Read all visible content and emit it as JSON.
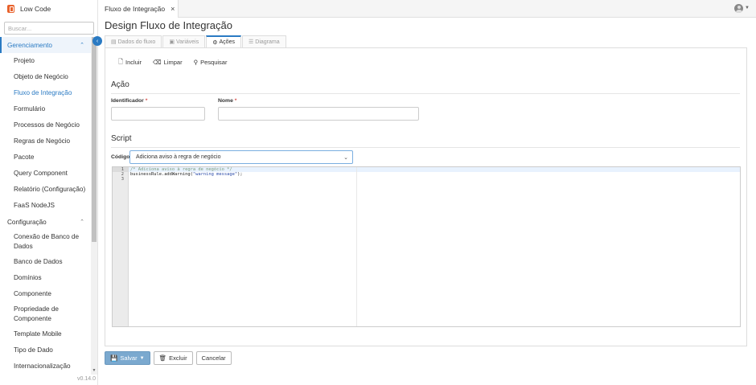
{
  "brand": {
    "name": "Low Code"
  },
  "sidebar": {
    "search_placeholder": "Buscar...",
    "groups": [
      {
        "label": "Gerenciamento",
        "expanded": true,
        "items": [
          "Projeto",
          "Objeto de Negócio",
          "Fluxo de Integração",
          "Formulário",
          "Processos de Negócio",
          "Regras de Negócio",
          "Pacote",
          "Query Component",
          "Relatório (Configuração)",
          "FaaS NodeJS"
        ]
      },
      {
        "label": "Configuração",
        "expanded": true,
        "items": [
          "Conexão de Banco de Dados",
          "Banco de Dados",
          "Domínios",
          "Componente",
          "Propriedade de Componente",
          "Template Mobile",
          "Tipo de Dado",
          "Internacionalização"
        ]
      }
    ],
    "active_item": "Fluxo de Integração",
    "version": "v0.14.0"
  },
  "topbar": {
    "tab_label": "Fluxo de Integração"
  },
  "page": {
    "title": "Design Fluxo de Integração",
    "tabs": [
      "Dados do fluxo",
      "Variáveis",
      "Ações",
      "Diagrama"
    ],
    "active_tab": "Ações"
  },
  "toolbar": {
    "add": "Incluir",
    "clear": "Limpar",
    "search": "Pesquisar"
  },
  "acao": {
    "heading": "Ação",
    "id_label": "Identificador",
    "name_label": "Nome",
    "required_mark": "*"
  },
  "script": {
    "heading": "Script",
    "code_label": "Código",
    "code_selected": "Adiciona aviso à regra de negócio",
    "line_numbers": [
      "1",
      "2",
      "3"
    ],
    "lines": [
      "/* Adiciona aviso à regra de negócio */",
      "businessRule.addWarning(\"warning message\");",
      ""
    ]
  },
  "footer": {
    "save": "Salvar",
    "delete": "Excluir",
    "cancel": "Cancelar"
  }
}
